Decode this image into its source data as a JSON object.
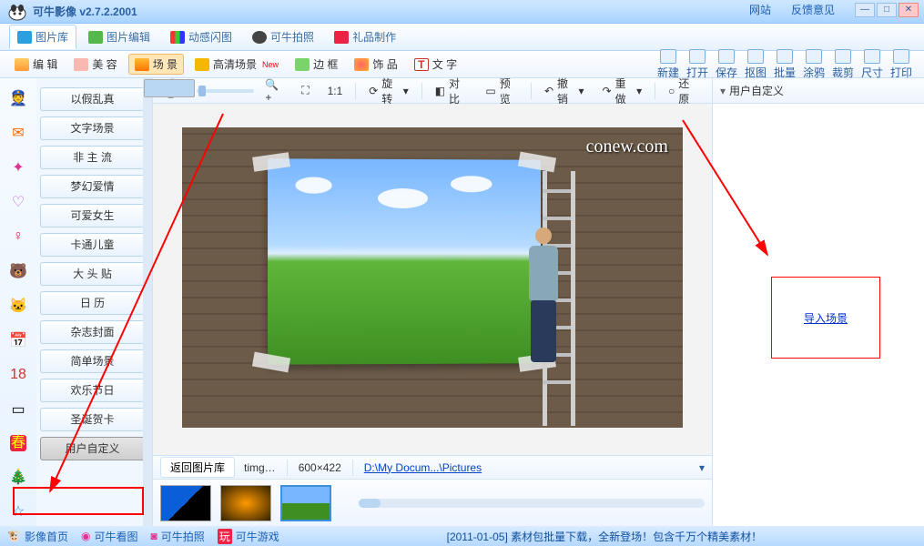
{
  "app": {
    "title": "可牛影像  v2.7.2.2001",
    "links": [
      "网站",
      "反馈意见"
    ]
  },
  "tabs": [
    {
      "label": "图片库"
    },
    {
      "label": "图片编辑"
    },
    {
      "label": "动感闪图"
    },
    {
      "label": "可牛拍照"
    },
    {
      "label": "礼品制作"
    }
  ],
  "toolbar": [
    {
      "label": "编 辑"
    },
    {
      "label": "美 容"
    },
    {
      "label": "场 景",
      "active": true
    },
    {
      "label": "高清场景",
      "badge": "New"
    },
    {
      "label": "边 框"
    },
    {
      "label": "饰 品"
    },
    {
      "label": "文 字"
    }
  ],
  "rtools": [
    "新建",
    "打开",
    "保存",
    "抠图",
    "批量",
    "涂鸦",
    "裁剪",
    "尺寸",
    "打印"
  ],
  "sidebar": [
    "以假乱真",
    "文字场景",
    "非 主 流",
    "梦幻爱情",
    "可爱女生",
    "卡通儿童",
    "大 头 贴",
    "日  历",
    "杂志封面",
    "简单场景",
    "欢乐节日",
    "圣诞贺卡",
    "用户自定义"
  ],
  "sidebarSelIdx": 12,
  "ctoolbar": {
    "ratio": "1:1",
    "rotate": "旋转",
    "compare": "对比",
    "preview": "预览",
    "undo": "撤销",
    "redo": "重做",
    "restore": "还原"
  },
  "watermark": "conew.com",
  "footbar": {
    "back": "返回图片库",
    "file": "timg…",
    "dim": "600×422",
    "path": "D:\\My Docum...\\Pictures"
  },
  "rightpane": {
    "title": "用户自定义",
    "import": "导入场景"
  },
  "statusbar": {
    "items": [
      "影像首页",
      "可牛看图",
      "可牛拍照",
      "可牛游戏"
    ],
    "center": "[2011-01-05]  素材包批量下载，全新登场！包含千万个精美素材！"
  }
}
